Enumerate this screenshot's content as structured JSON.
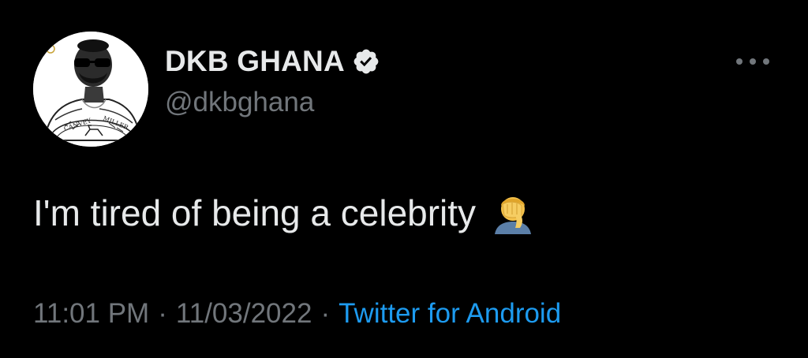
{
  "author": {
    "display_name": "DKB GHANA",
    "handle": "@dkbghana",
    "verified": true,
    "verified_color": "#e7e9ea",
    "avatar_logo_text": "CANVEY MILLER"
  },
  "tweet": {
    "text": "I'm tired of being a celebrity",
    "emoji": "face-palm-emoji"
  },
  "meta": {
    "time": "11:01 PM",
    "separator": "·",
    "date": "11/03/2022",
    "source": "Twitter for Android"
  },
  "menu": {
    "icon": "more-horizontal-icon"
  },
  "colors": {
    "background": "#000000",
    "primary_text": "#e7e9ea",
    "secondary_text": "#71767b",
    "accent": "#1d9bf0"
  }
}
